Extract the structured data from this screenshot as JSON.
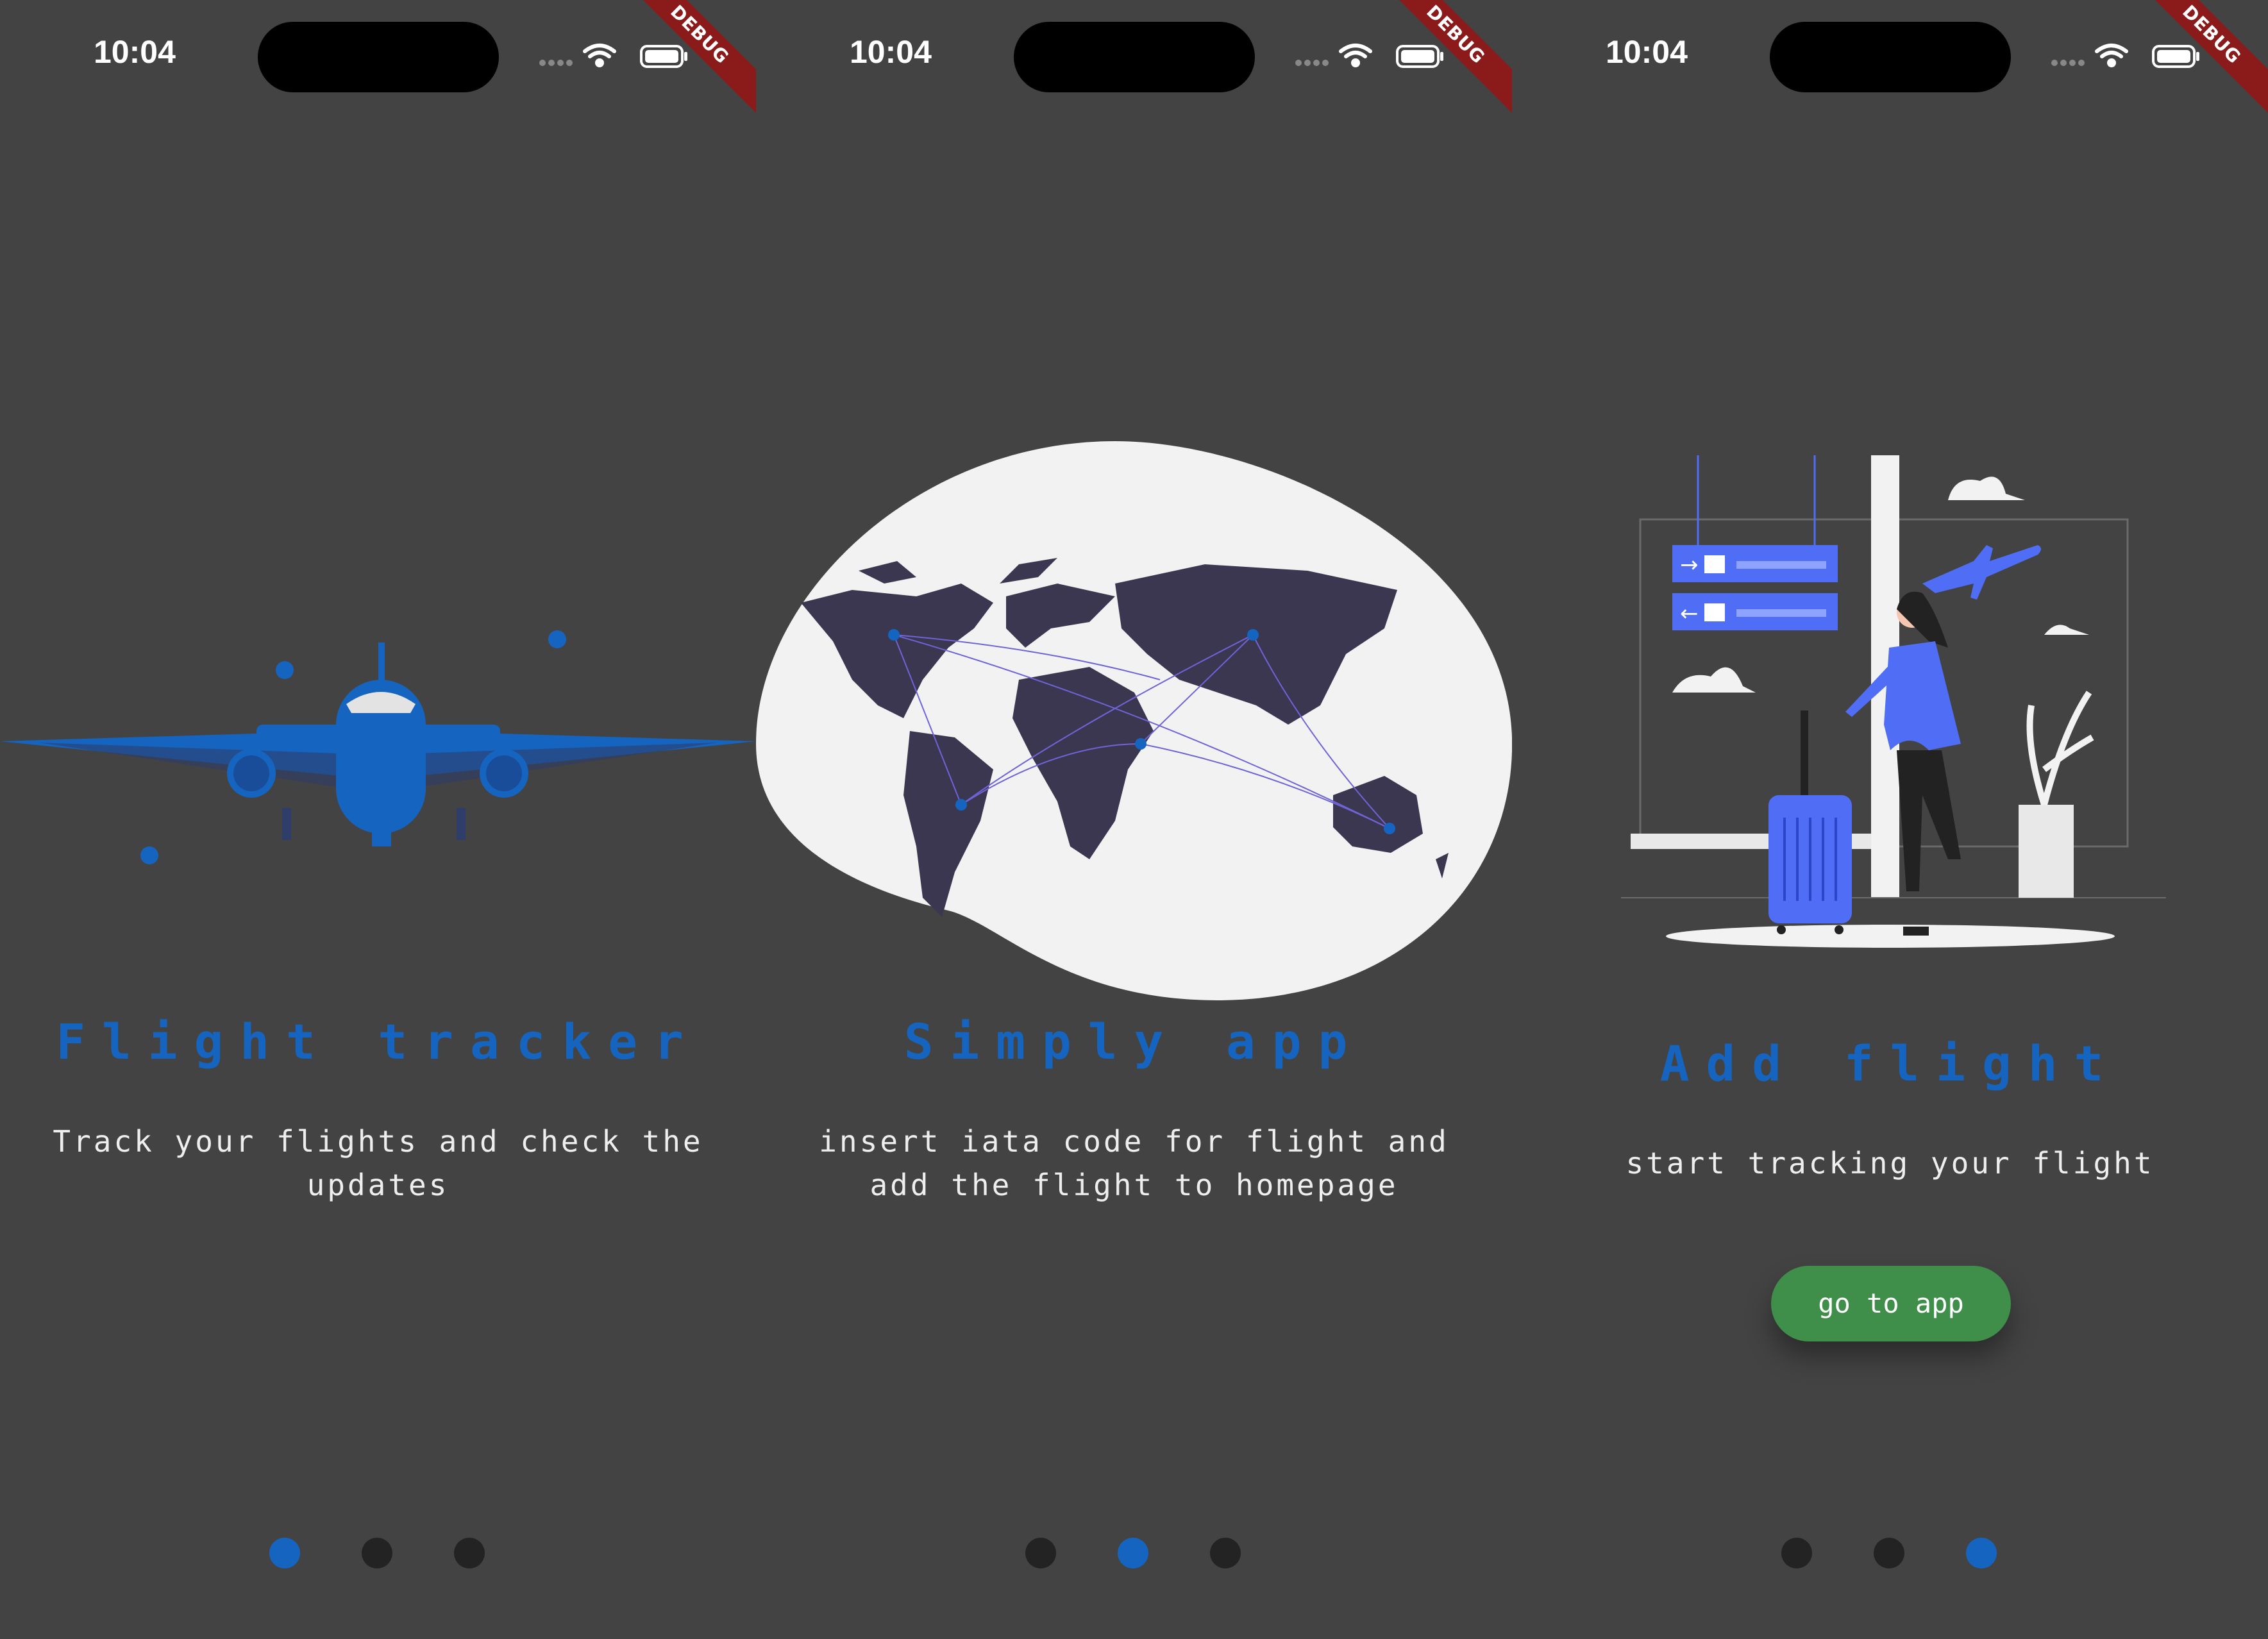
{
  "status": {
    "time": "10:04",
    "debug_label": "DEBUG"
  },
  "colors": {
    "accent": "#1565c0",
    "background": "#434343",
    "dot_inactive": "#232323",
    "button": "#3f8f4a"
  },
  "pages": [
    {
      "title": "Flight tracker",
      "description": "Track your flights and check the updates",
      "illustration": "airplane-illustration",
      "active_dot": 0
    },
    {
      "title": "Simply app",
      "description": "insert iata code for flight and add the flight to homepage",
      "illustration": "world-map-illustration",
      "active_dot": 1
    },
    {
      "title": "Add flight",
      "description": "start tracking your flight",
      "illustration": "traveler-illustration",
      "active_dot": 2,
      "button_label": "go to app"
    }
  ]
}
